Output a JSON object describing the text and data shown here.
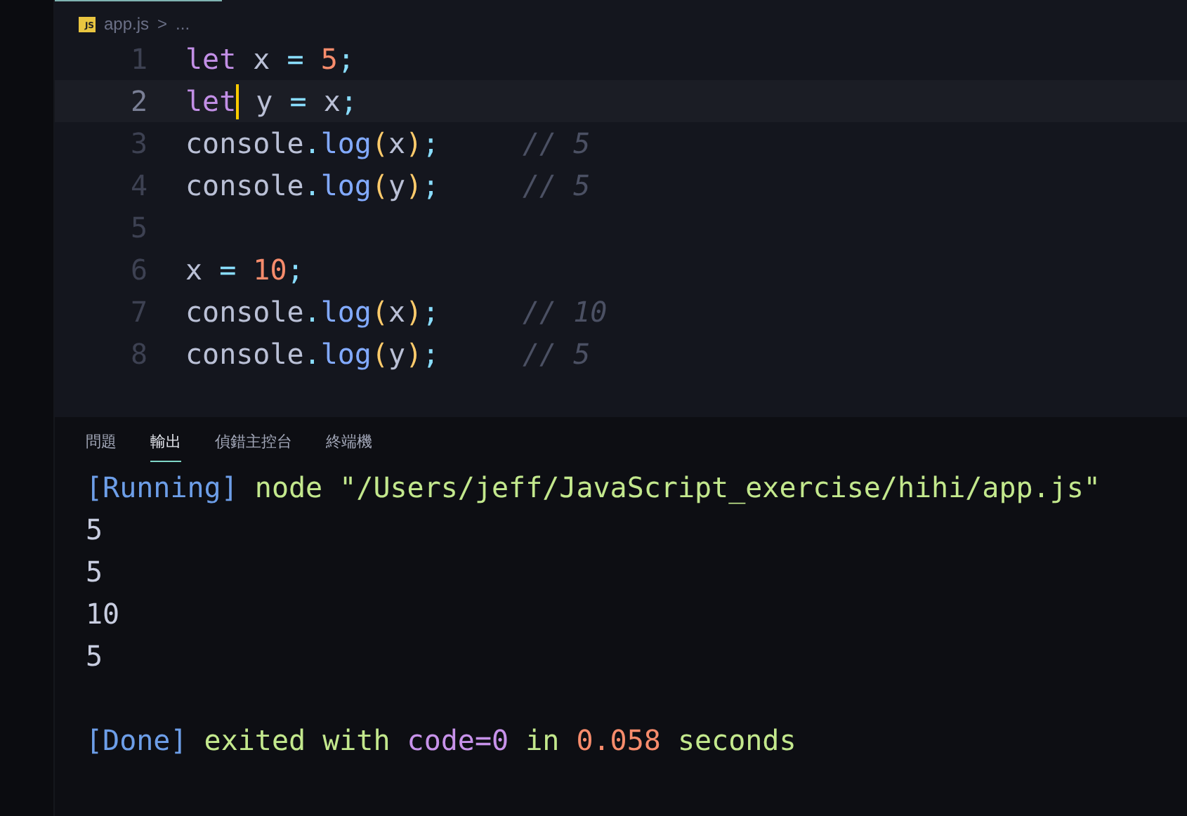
{
  "editor": {
    "tab": {
      "icon_label": "JS",
      "filename": "app.js",
      "breadcrumb_sep": ">",
      "breadcrumb_rest": "..."
    },
    "lines": [
      {
        "number": "1",
        "active": false,
        "tokens": [
          {
            "kind": "keyword",
            "text": "let"
          },
          {
            "kind": "ident",
            "text": " x "
          },
          {
            "kind": "op",
            "text": "="
          },
          {
            "kind": "number",
            "text": " 5"
          },
          {
            "kind": "punct",
            "text": ";"
          }
        ]
      },
      {
        "number": "2",
        "active": true,
        "tokens": [
          {
            "kind": "keyword",
            "text": "let"
          },
          {
            "kind": "ident",
            "text": " y "
          },
          {
            "kind": "op",
            "text": "="
          },
          {
            "kind": "ident",
            "text": " x"
          },
          {
            "kind": "punct",
            "text": ";"
          }
        ]
      },
      {
        "number": "3",
        "active": false,
        "tokens": [
          {
            "kind": "ident",
            "text": "console"
          },
          {
            "kind": "punct",
            "text": "."
          },
          {
            "kind": "func",
            "text": "log"
          },
          {
            "kind": "paren",
            "text": "("
          },
          {
            "kind": "ident",
            "text": "x"
          },
          {
            "kind": "paren",
            "text": ")"
          },
          {
            "kind": "punct",
            "text": ";"
          }
        ],
        "comment": "// 5"
      },
      {
        "number": "4",
        "active": false,
        "tokens": [
          {
            "kind": "ident",
            "text": "console"
          },
          {
            "kind": "punct",
            "text": "."
          },
          {
            "kind": "func",
            "text": "log"
          },
          {
            "kind": "paren",
            "text": "("
          },
          {
            "kind": "ident",
            "text": "y"
          },
          {
            "kind": "paren",
            "text": ")"
          },
          {
            "kind": "punct",
            "text": ";"
          }
        ],
        "comment": "// 5"
      },
      {
        "number": "5",
        "active": false
      },
      {
        "number": "6",
        "active": false,
        "tokens": [
          {
            "kind": "ident",
            "text": "x "
          },
          {
            "kind": "op",
            "text": "="
          },
          {
            "kind": "number",
            "text": " 10"
          },
          {
            "kind": "punct",
            "text": ";"
          }
        ]
      },
      {
        "number": "7",
        "active": false,
        "tokens": [
          {
            "kind": "ident",
            "text": "console"
          },
          {
            "kind": "punct",
            "text": "."
          },
          {
            "kind": "func",
            "text": "log"
          },
          {
            "kind": "paren",
            "text": "("
          },
          {
            "kind": "ident",
            "text": "x"
          },
          {
            "kind": "paren",
            "text": ")"
          },
          {
            "kind": "punct",
            "text": ";"
          }
        ],
        "comment": "// 10"
      },
      {
        "number": "8",
        "active": false,
        "tokens": [
          {
            "kind": "ident",
            "text": "console"
          },
          {
            "kind": "punct",
            "text": "."
          },
          {
            "kind": "func",
            "text": "log"
          },
          {
            "kind": "paren",
            "text": "("
          },
          {
            "kind": "ident",
            "text": "y"
          },
          {
            "kind": "paren",
            "text": ")"
          },
          {
            "kind": "punct",
            "text": ";"
          }
        ],
        "comment": "// 5"
      }
    ]
  },
  "panel": {
    "tabs": [
      {
        "label": "問題",
        "selected": false
      },
      {
        "label": "輸出",
        "selected": true
      },
      {
        "label": "偵錯主控台",
        "selected": false
      },
      {
        "label": "終端機",
        "selected": false
      }
    ],
    "output": [
      {
        "segments": [
          {
            "kind": "tag",
            "text": "[Running]"
          },
          {
            "kind": "text",
            "text": " node \"/Users/jeff/JavaScript_exercise/hihi/app.js\""
          }
        ]
      },
      {
        "segments": [
          {
            "kind": "plain",
            "text": "5"
          }
        ]
      },
      {
        "segments": [
          {
            "kind": "plain",
            "text": "5"
          }
        ]
      },
      {
        "segments": [
          {
            "kind": "plain",
            "text": "10"
          }
        ]
      },
      {
        "segments": [
          {
            "kind": "plain",
            "text": "5"
          }
        ]
      }
    ],
    "summary": {
      "segments": [
        {
          "kind": "tag",
          "text": "[Done]"
        },
        {
          "kind": "text",
          "text": " exited with "
        },
        {
          "kind": "code",
          "text": "code=0"
        },
        {
          "kind": "text",
          "text": " in "
        },
        {
          "kind": "num",
          "text": "0.058"
        },
        {
          "kind": "text",
          "text": " seconds"
        }
      ]
    }
  }
}
